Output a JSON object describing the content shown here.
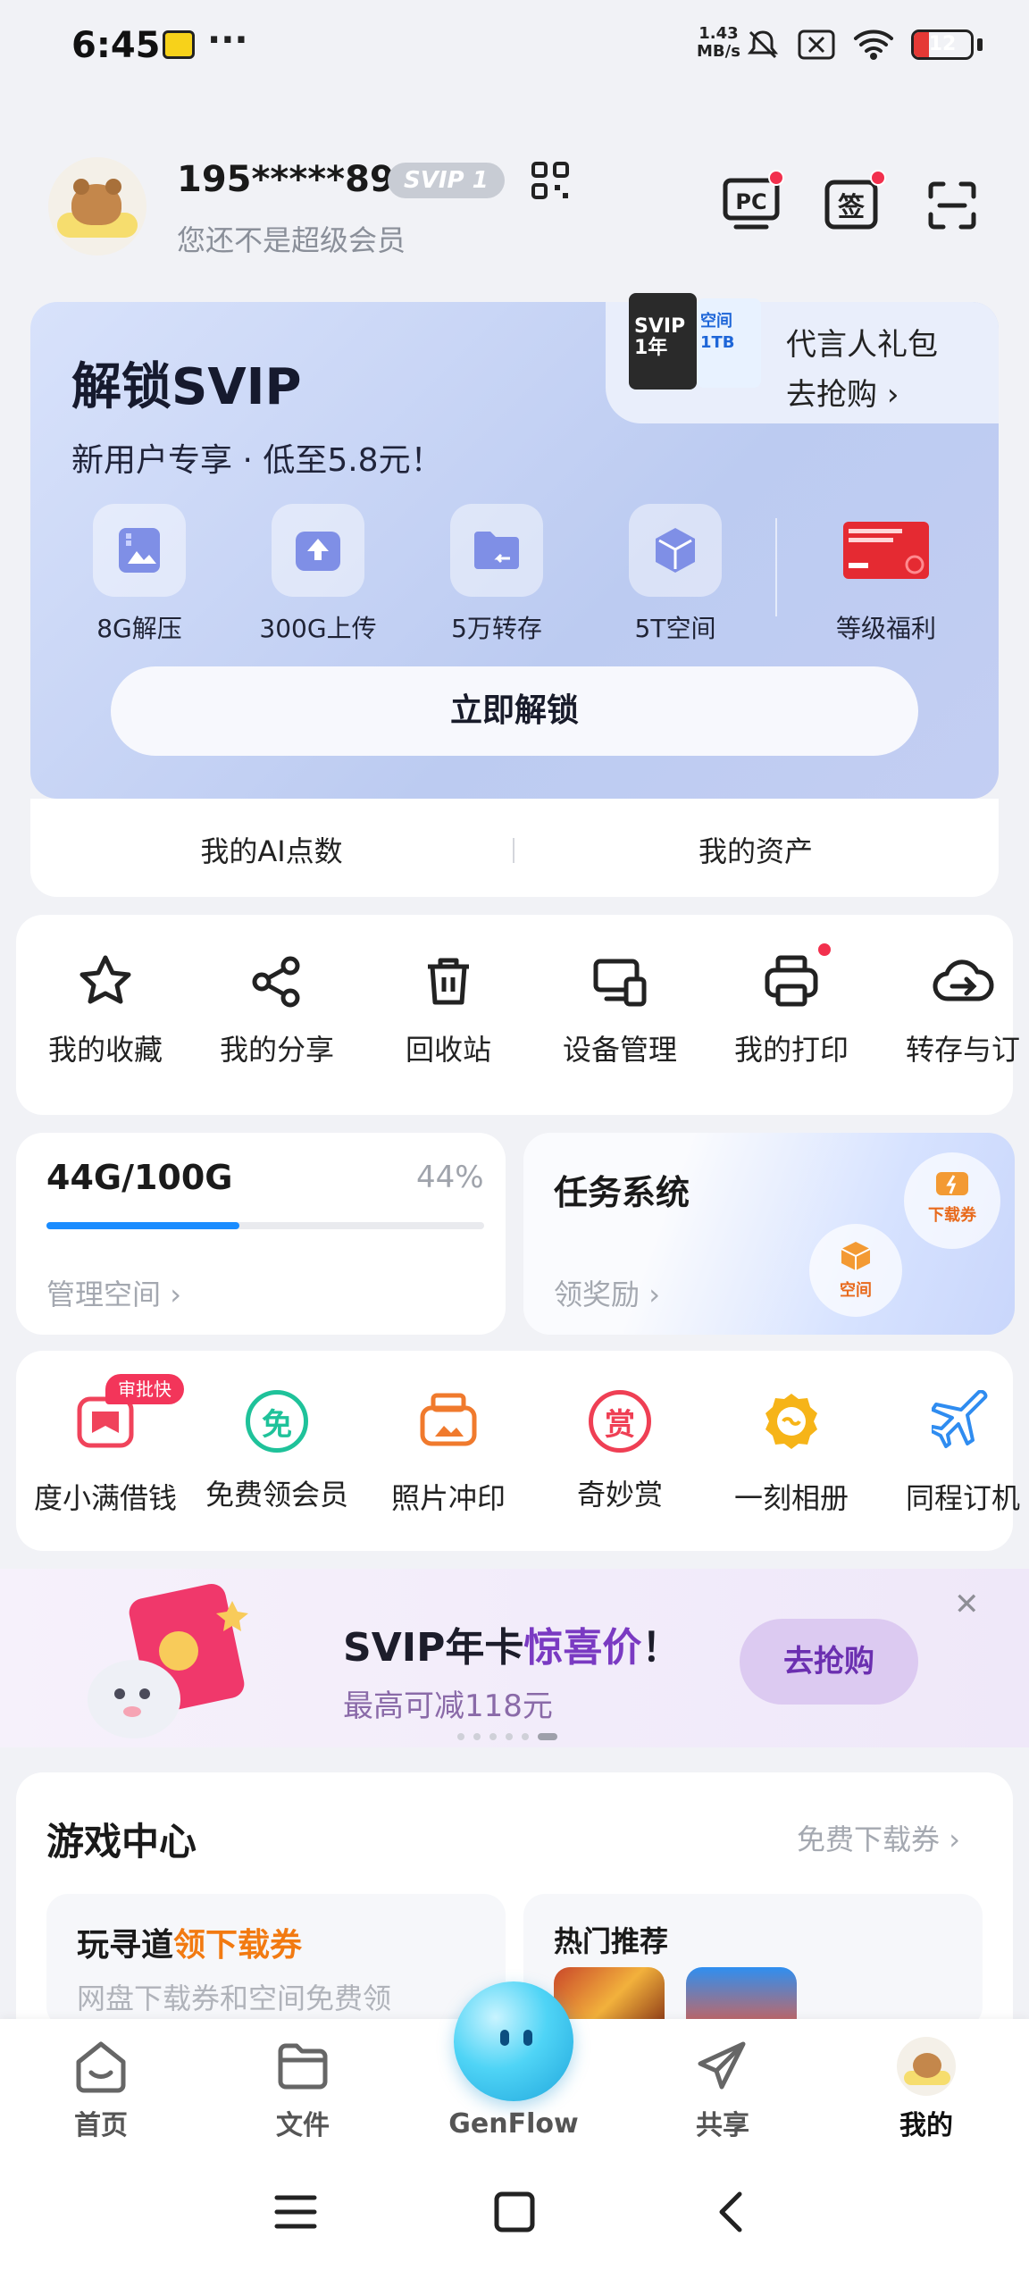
{
  "status_bar": {
    "time": "6:45",
    "more": "···",
    "net_speed_value": "1.43",
    "net_speed_unit": "MB/s",
    "battery": "12"
  },
  "profile": {
    "user_id": "195*****896",
    "badge": "SVIP 1",
    "subtitle": "您还不是超级会员",
    "pc_icon_label": "PC",
    "sign_icon_label": "签"
  },
  "svip_card": {
    "title": "解锁SVIP",
    "subtitle": "新用户专享 · 低至5.8元！",
    "gift_title": "代言人礼包",
    "gift_link": "去抢购",
    "gift_card1": "SVIP 1年",
    "gift_card2": "空间 1TB",
    "perks": [
      {
        "label": "8G解压",
        "icon": "archive-icon"
      },
      {
        "label": "300G上传",
        "icon": "upload-icon"
      },
      {
        "label": "5万转存",
        "icon": "folder-transfer-icon"
      },
      {
        "label": "5T空间",
        "icon": "space-icon"
      },
      {
        "label": "等级福利",
        "icon": "coupon-icon"
      }
    ],
    "unlock_button": "立即解锁",
    "ai_points": "我的AI点数",
    "my_assets": "我的资产"
  },
  "tools": [
    {
      "label": "我的收藏",
      "icon": "star-icon"
    },
    {
      "label": "我的分享",
      "icon": "share-icon"
    },
    {
      "label": "回收站",
      "icon": "trash-icon"
    },
    {
      "label": "设备管理",
      "icon": "devices-icon"
    },
    {
      "label": "我的打印",
      "icon": "printer-icon"
    },
    {
      "label": "转存与订",
      "icon": "cloud-transfer-icon"
    }
  ],
  "storage": {
    "usage": "44G/100G",
    "percent_text": "44%",
    "percent": 44,
    "manage_link": "管理空间"
  },
  "task": {
    "title": "任务系统",
    "link": "领奖励",
    "bubble_download": "下载券",
    "bubble_space": "空间"
  },
  "services": [
    {
      "label": "度小满借钱",
      "icon": "wallet-icon",
      "tag": "审批快"
    },
    {
      "label": "免费领会员",
      "icon": "free-icon",
      "glyph": "免"
    },
    {
      "label": "照片冲印",
      "icon": "photo-print-icon"
    },
    {
      "label": "奇妙赏",
      "icon": "reward-icon",
      "glyph": "赏"
    },
    {
      "label": "一刻相册",
      "icon": "album-icon"
    },
    {
      "label": "同程订机",
      "icon": "plane-icon"
    }
  ],
  "promo": {
    "title_prefix": "SVIP年卡",
    "title_highlight": "惊喜价",
    "title_suffix": "！",
    "subtitle": "最高可减118元",
    "button": "去抢购",
    "close": "✕"
  },
  "game_center": {
    "title": "游戏中心",
    "more": "免费下载券",
    "card1_prefix": "玩寻道",
    "card1_highlight": "领下载券",
    "card1_sub": "网盘下载券和空间免费领",
    "card2_title": "热门推荐"
  },
  "bottom_nav": {
    "home": "首页",
    "files": "文件",
    "genflow": "GenFlow",
    "share": "共享",
    "mine": "我的"
  }
}
